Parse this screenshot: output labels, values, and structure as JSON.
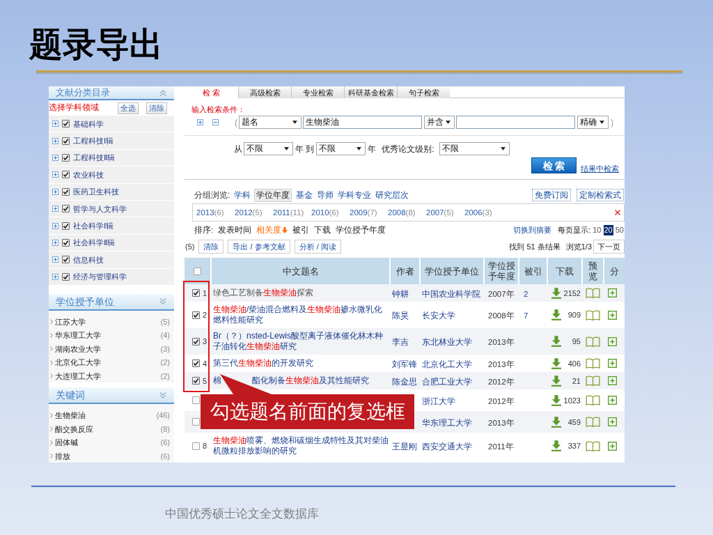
{
  "slide": {
    "title": "题录导出",
    "footer": "中国优秀硕士论文全文数据库"
  },
  "sidebar": {
    "category_panel": {
      "title": "文献分类目录",
      "select_label": "选择学科领域",
      "buttons": [
        "全选",
        "清除"
      ],
      "items": [
        {
          "label": "基础科学",
          "checked": true
        },
        {
          "label": "工程科技Ⅰ辑",
          "checked": true
        },
        {
          "label": "工程科技Ⅱ辑",
          "checked": true
        },
        {
          "label": "农业科技",
          "checked": true
        },
        {
          "label": "医药卫生科技",
          "checked": true
        },
        {
          "label": "哲学与人文科学",
          "checked": true
        },
        {
          "label": "社会科学Ⅰ辑",
          "checked": true
        },
        {
          "label": "社会科学Ⅱ辑",
          "checked": true
        },
        {
          "label": "信息科技",
          "checked": true
        },
        {
          "label": "经济与管理科学",
          "checked": true
        }
      ]
    },
    "facets": [
      {
        "title": "学位授予单位",
        "items": [
          {
            "label": "江苏大学",
            "count": "(5)"
          },
          {
            "label": "华东理工大学",
            "count": "(4)"
          },
          {
            "label": "湖南农业大学",
            "count": "(3)"
          },
          {
            "label": "北京化工大学",
            "count": "(2)"
          },
          {
            "label": "大连理工大学",
            "count": "(2)"
          }
        ]
      },
      {
        "title": "关键词",
        "items": [
          {
            "label": "生物柴油",
            "count": "(46)"
          },
          {
            "label": "酯交换反应",
            "count": "(8)"
          },
          {
            "label": "固体碱",
            "count": "(6)"
          },
          {
            "label": "排放",
            "count": "(6)"
          }
        ]
      }
    ]
  },
  "search": {
    "tabs": [
      {
        "label": "检 索",
        "selected": true
      },
      {
        "label": "高级检索",
        "selected": false
      },
      {
        "label": "专业检索",
        "selected": false
      },
      {
        "label": "科研基金检索",
        "selected": false
      },
      {
        "label": "句子检索",
        "selected": false
      }
    ],
    "condition_label": "输入检索条件：",
    "open_paren": "(",
    "field_select": "题名",
    "query": "生物柴油",
    "operator_select": "并含",
    "match_select": "精确",
    "close_paren": ")",
    "from_label": "从",
    "year_from": "不限",
    "year_to_label": "年 到",
    "year_to": "不限",
    "year_suffix": "年",
    "level_label": "优秀论文级别:",
    "level_select": "不限",
    "search_button": "检 索",
    "refine_link": "结果中检索"
  },
  "results": {
    "group_label": "分组浏览:",
    "groups": [
      {
        "label": "学科",
        "selected": false
      },
      {
        "label": "学位年度",
        "selected": true
      },
      {
        "label": "基金",
        "selected": false
      },
      {
        "label": "导师",
        "selected": false
      },
      {
        "label": "学科专业",
        "selected": false
      },
      {
        "label": "研究层次",
        "selected": false
      }
    ],
    "right_buttons": [
      "免费订阅",
      "定制检索式"
    ],
    "years": [
      {
        "year": "2013",
        "count": "(6)"
      },
      {
        "year": "2012",
        "count": "(5)"
      },
      {
        "year": "2011",
        "count": "(11)"
      },
      {
        "year": "2010",
        "count": "(6)"
      },
      {
        "year": "2009",
        "count": "(7)"
      },
      {
        "year": "2008",
        "count": "(8)"
      },
      {
        "year": "2007",
        "count": "(5)"
      },
      {
        "year": "2006",
        "count": "(3)"
      }
    ],
    "sort_label": "排序:",
    "sort_options": [
      {
        "label": "发表时间",
        "selected": false
      },
      {
        "label": "相关度",
        "selected": true
      },
      {
        "label": "被引",
        "selected": false
      },
      {
        "label": "下载",
        "selected": false
      },
      {
        "label": "学位授予年度",
        "selected": false
      }
    ],
    "switch_link": "切换到摘要",
    "per_page_label": "每页显示:",
    "per_page": [
      {
        "label": "10",
        "selected": false
      },
      {
        "label": "20",
        "selected": true
      },
      {
        "label": "50",
        "selected": false
      }
    ],
    "selected_count": "(5)",
    "actions": [
      "清除",
      "导出 / 参考文献",
      "分析 / 阅读"
    ],
    "found": "找到 51 条结果",
    "page_info": "浏览1/3",
    "next_button": "下一页"
  },
  "table": {
    "select_all_checked": false,
    "columns": [
      "中文题名",
      "作者",
      "学位授予单位",
      "学位授予年度",
      "被引",
      "下载",
      "预览",
      "分"
    ],
    "rows": [
      {
        "checked": true,
        "number": "1",
        "visited": true,
        "title": "绿色工艺制备**生物柴油**探索",
        "author": "钟耕",
        "unit": "中国农业科学院",
        "year": "2007年",
        "cited": "2",
        "downloads": "2152"
      },
      {
        "checked": true,
        "number": "2",
        "visited": false,
        "title": "**生物柴油**/柴油混合燃料及**生物柴油**掺水微乳化燃料性能研究",
        "author": "陈昊",
        "unit": "长安大学",
        "year": "2008年",
        "cited": "7",
        "downloads": "909"
      },
      {
        "checked": true,
        "number": "3",
        "visited": false,
        "title": "Br（？）nsted-Lewis酸型离子液体催化林木种子油转化**生物柴油**研究",
        "author": "李吉",
        "unit": "东北林业大学",
        "year": "2013年",
        "downloads": "95"
      },
      {
        "checked": true,
        "number": "4",
        "visited": false,
        "title": "第三代**生物柴油**的开发研究",
        "author": "刘军锋",
        "unit": "北京化工大学",
        "year": "2013年",
        "downloads": "406"
      },
      {
        "checked": true,
        "number": "5",
        "visited": false,
        "title": "棉",
        "title_continued": "酯化制备**生物柴油**及其性能研究",
        "author": "陈金思",
        "unit": "合肥工业大学",
        "year": "2012年",
        "downloads": "21"
      },
      {
        "checked": false,
        "unit": "浙江大学",
        "year": "2012年",
        "downloads": "1023"
      },
      {
        "checked": false,
        "unit": "华东理工大学",
        "year": "2013年",
        "downloads": "459"
      },
      {
        "checked": false,
        "number": "8",
        "visited": false,
        "title": "**生物柴油**喷雾、燃烧和碳烟生成特性及其对柴油机微粒排放影响的研究",
        "author": "王昱刚",
        "unit": "西安交通大学",
        "year": "2011年",
        "downloads": "337"
      }
    ]
  },
  "callout": {
    "text": "勾选题名前面的复选框"
  }
}
